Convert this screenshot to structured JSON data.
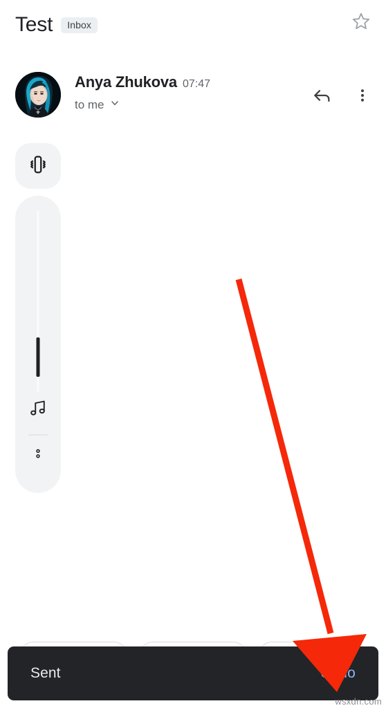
{
  "app": {
    "name": "gmail-email-thread"
  },
  "header": {
    "subject": "Test",
    "label_badge": "Inbox",
    "star_icon": "star-outline-icon"
  },
  "message": {
    "sender_name": "Anya Zhukova",
    "timestamp": "07:47",
    "recipients": "to me",
    "expand_icon": "chevron-down-icon",
    "avatar_alt": "avatar",
    "reply_icon": "reply-arrow-icon",
    "more_icon": "kebab-menu-icon"
  },
  "volume_overlay": {
    "ringer_mode_icon": "vibrate-icon",
    "stream_icon": "music-note-icon",
    "settings_icon": "two-dots-icon",
    "slider": {
      "level_percent": 18,
      "orientation": "vertical"
    }
  },
  "actions": {
    "buttons": [
      "",
      "",
      ""
    ]
  },
  "snackbar": {
    "message": "Sent",
    "action_label": "Undo",
    "action_color": "#8ab4f8",
    "background_color": "#222427"
  },
  "annotation": {
    "arrow_color": "#f5280a",
    "points_to": "Undo"
  },
  "watermark": {
    "text": "wsxdn.com"
  }
}
